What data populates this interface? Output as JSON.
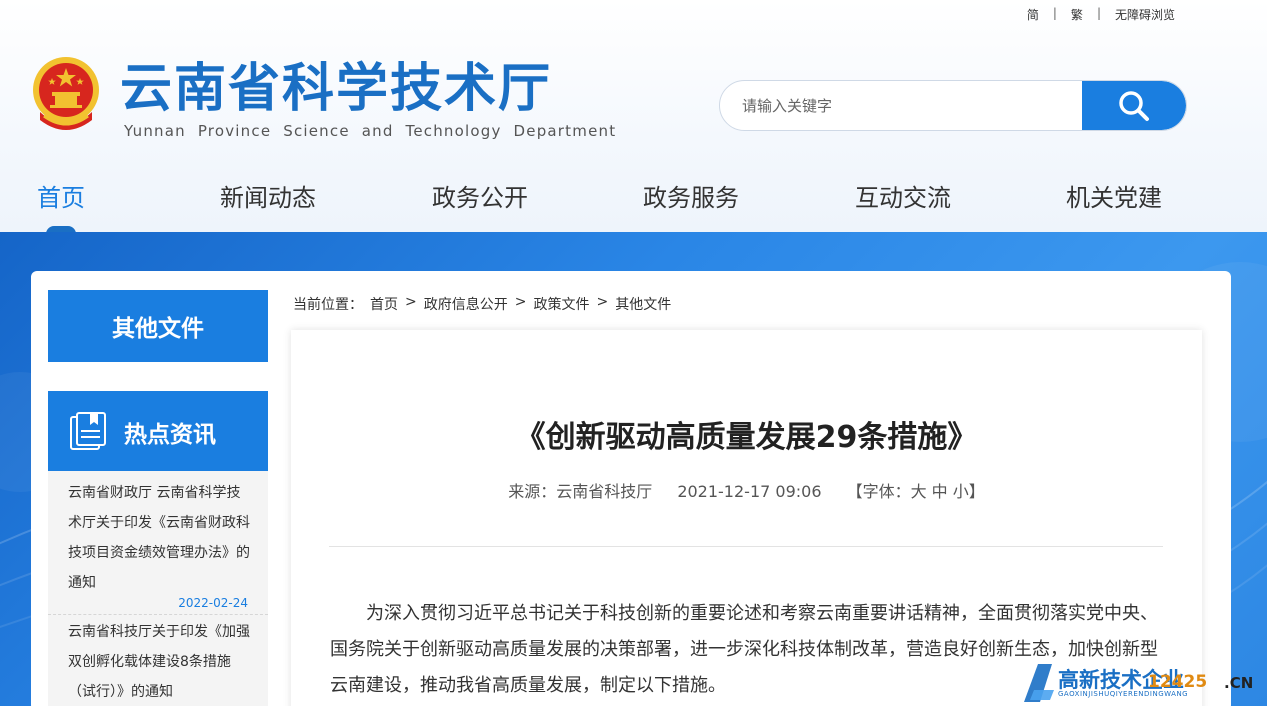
{
  "toplinks": {
    "simplified": "简",
    "traditional": "繁",
    "accessibility": "无障碍浏览",
    "separator": "|"
  },
  "site": {
    "title": "云南省科学技术厅",
    "subtitle": "Yunnan Province Science and Technology Department"
  },
  "search": {
    "placeholder": "请输入关键字",
    "icon": "search-icon"
  },
  "nav": {
    "items": [
      {
        "label": "首页",
        "active": true
      },
      {
        "label": "新闻动态"
      },
      {
        "label": "政务公开"
      },
      {
        "label": "政务服务"
      },
      {
        "label": "互动交流"
      },
      {
        "label": "机关党建"
      }
    ]
  },
  "sidebar": {
    "section_title": "其他文件",
    "hot_title": "热点资讯",
    "hot_icon": "document-list-icon",
    "hot_items": [
      {
        "text": "云南省财政厅 云南省科学技术厅关于印发《云南省财政科技项目资金绩效管理办法》的通知",
        "date": "2022-02-24"
      },
      {
        "text": "云南省科技厅关于印发《加强双创孵化载体建设8条措施（试行）》的通知"
      }
    ]
  },
  "breadcrumb": {
    "prefix": "当前位置：",
    "items": [
      "首页",
      "政府信息公开",
      "政策文件",
      "其他文件"
    ],
    "separator": ">"
  },
  "article": {
    "title": "《创新驱动高质量发展29条措施》",
    "source": "来源：云南省科技厅",
    "datetime": "2021-12-17 09:06",
    "font_size_label": "【字体：大 中 小】",
    "body": "为深入贯彻习近平总书记关于科技创新的重要论述和考察云南重要讲话精神，全面贯彻落实党中央、国务院关于创新驱动高质量发展的决策部署，进一步深化科技体制改革，营造良好创新生态，加快创新型云南建设，推动我省高质量发展，制定以下措施。"
  },
  "watermark": {
    "brand": "高新技术企业",
    "number": "12425",
    "tld": ".CN",
    "sub": "GAOXINJISHUQIYERENDINGWANG"
  },
  "colors": {
    "primary": "#1a7ee0",
    "title": "#1a6fc4",
    "emblem_red": "#d7261e",
    "emblem_gold": "#f2c230"
  }
}
